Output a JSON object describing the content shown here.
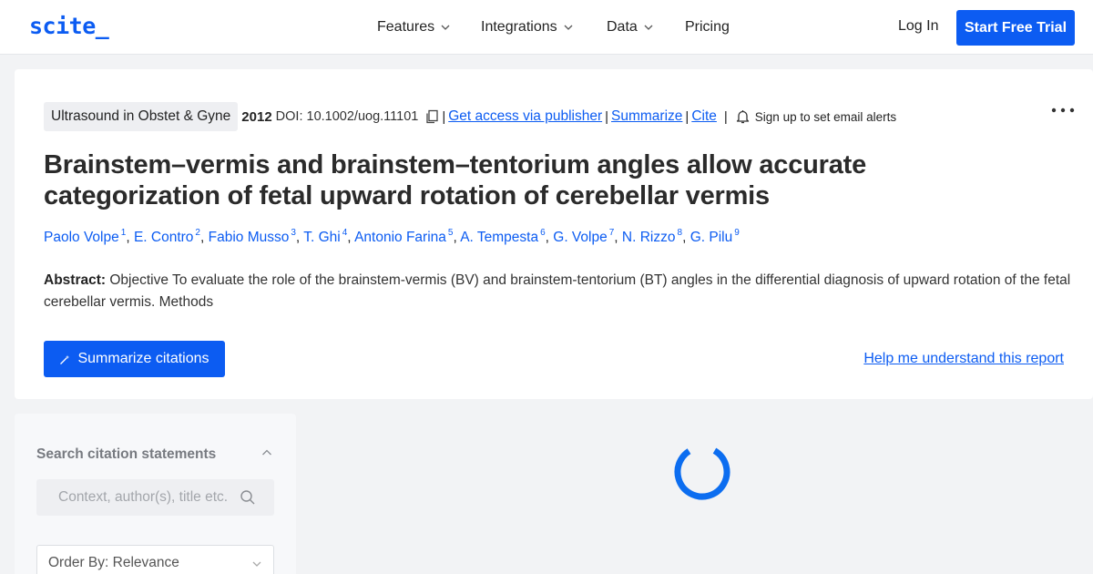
{
  "brand": {
    "logo": "scite_",
    "accent": "#0c5cf2"
  },
  "nav": {
    "items": [
      {
        "label": "Features",
        "has_menu": true
      },
      {
        "label": "Integrations",
        "has_menu": true
      },
      {
        "label": "Data",
        "has_menu": true
      },
      {
        "label": "Pricing",
        "has_menu": false
      }
    ],
    "login": "Log In",
    "cta": "Start Free Trial"
  },
  "paper": {
    "journal": "Ultrasound in Obstet & Gyne",
    "year": "2012",
    "doi": "DOI: 10.1002/uog.11101",
    "links": {
      "access": "Get access via publisher",
      "summarize": "Summarize",
      "cite": "Cite"
    },
    "alert": "Sign up to set email alerts",
    "title": "Brainstem–vermis and brainstem–tentorium angles allow accurate categorization of fetal upward rotation of cerebellar vermis",
    "authors": [
      {
        "name": "Paolo Volpe",
        "sup": "1"
      },
      {
        "name": "E. Contro",
        "sup": "2"
      },
      {
        "name": "Fabio Musso",
        "sup": "3"
      },
      {
        "name": "T. Ghi",
        "sup": "4"
      },
      {
        "name": "Antonio Farina",
        "sup": "5"
      },
      {
        "name": "A. Tempesta",
        "sup": "6"
      },
      {
        "name": "G. Volpe",
        "sup": "7"
      },
      {
        "name": "N. Rizzo",
        "sup": "8"
      },
      {
        "name": "G. Pilu",
        "sup": "9"
      }
    ],
    "abstract_label": "Abstract:",
    "abstract_text": "Objective To evaluate the role of the brainstem-vermis (BV) and brainstem-tentorium (BT) angles in the differential diagnosis of upward rotation of the fetal cerebellar vermis. Methods",
    "summarize_button": "Summarize citations",
    "help_link": "Help me understand this report"
  },
  "sidebar": {
    "heading": "Search citation statements",
    "search": {
      "placeholder": "Context, author(s), title etc.",
      "value": ""
    },
    "order_by": "Order By: Relevance"
  },
  "icons": {
    "chevron": "chevron-down-icon",
    "copy": "copy-icon",
    "bell": "bell-icon",
    "more": "more-icon",
    "wand": "magic-wand-icon",
    "search": "search-icon",
    "spinner": "loading-spinner-icon"
  }
}
